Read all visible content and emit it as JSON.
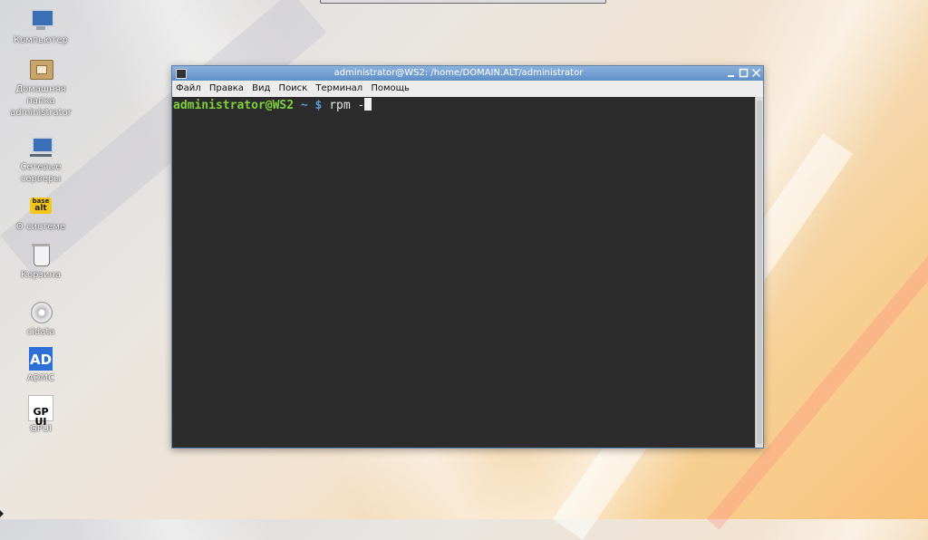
{
  "desktop": {
    "icons": [
      {
        "label": "Компьютер",
        "icon": "computer-icon"
      },
      {
        "label": "Домашняя\nпапка\nadministrator",
        "icon": "home-folder-icon"
      },
      {
        "label": "Сетевые\nсерверы",
        "icon": "network-servers-icon"
      },
      {
        "label": "О системе",
        "icon": "about-system-icon"
      },
      {
        "label": "Корзина",
        "icon": "trash-icon"
      },
      {
        "label": "cidata",
        "icon": "disc-icon"
      },
      {
        "label": "ADMC",
        "icon": "admc-icon",
        "badge": "AD"
      },
      {
        "label": "GPUI",
        "icon": "gpui-icon",
        "badge": "GP\nUI"
      }
    ],
    "about_badge_top": "base",
    "about_badge_main": "alt"
  },
  "window": {
    "title": "administrator@WS2: /home/DOMAIN.ALT/administrator",
    "menu": [
      "Файл",
      "Правка",
      "Вид",
      "Поиск",
      "Терминал",
      "Помощь"
    ],
    "prompt_user": "administrator@WS2",
    "prompt_path": "~ $",
    "command": "rpm -"
  },
  "colors": {
    "titlebar": "#6f9bd0",
    "terminal_bg": "#2d2c2c",
    "prompt_user": "#7fd13b",
    "prompt_path": "#5b9bd5"
  }
}
